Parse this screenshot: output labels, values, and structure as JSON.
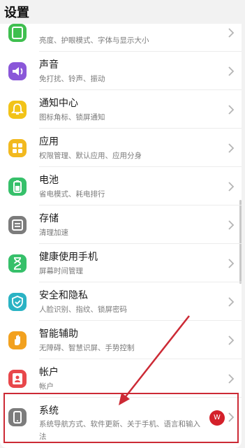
{
  "header": {
    "title": "设置"
  },
  "items": [
    {
      "title": "",
      "subtitle": "亮度、护眼模式、字体与显示大小",
      "icon": "display-icon",
      "color": "#3fbf4f"
    },
    {
      "title": "声音",
      "subtitle": "免打扰、铃声、振动",
      "icon": "sound-icon",
      "color": "#8a57d9"
    },
    {
      "title": "通知中心",
      "subtitle": "图标角标、锁屏通知",
      "icon": "bell-icon",
      "color": "#f2c318"
    },
    {
      "title": "应用",
      "subtitle": "权限管理、默认应用、应用分身",
      "icon": "apps-icon",
      "color": "#f2b91f"
    },
    {
      "title": "电池",
      "subtitle": "省电模式、耗电排行",
      "icon": "battery-icon",
      "color": "#36c06a"
    },
    {
      "title": "存储",
      "subtitle": "清理加速",
      "icon": "storage-icon",
      "color": "#7c7c7c"
    },
    {
      "title": "健康使用手机",
      "subtitle": "屏幕时间管理",
      "icon": "hourglass-icon",
      "color": "#36c06a"
    },
    {
      "title": "安全和隐私",
      "subtitle": "人脸识别、指纹、锁屏密码",
      "icon": "shield-icon",
      "color": "#2ab3c4"
    },
    {
      "title": "智能辅助",
      "subtitle": "无障碍、智慧识屏、手势控制",
      "icon": "hand-icon",
      "color": "#f2a11f"
    },
    {
      "title": "帐户",
      "subtitle": "帐户",
      "icon": "account-icon",
      "color": "#e8474b"
    },
    {
      "title": "系统",
      "subtitle": "系统导航方式、软件更新、关于手机、语言和输入法",
      "icon": "phone-icon",
      "color": "#7c7c7c"
    }
  ],
  "system_badge": "W",
  "colors": {
    "annotation": "#cc2a35",
    "badge": "#d4202a"
  }
}
